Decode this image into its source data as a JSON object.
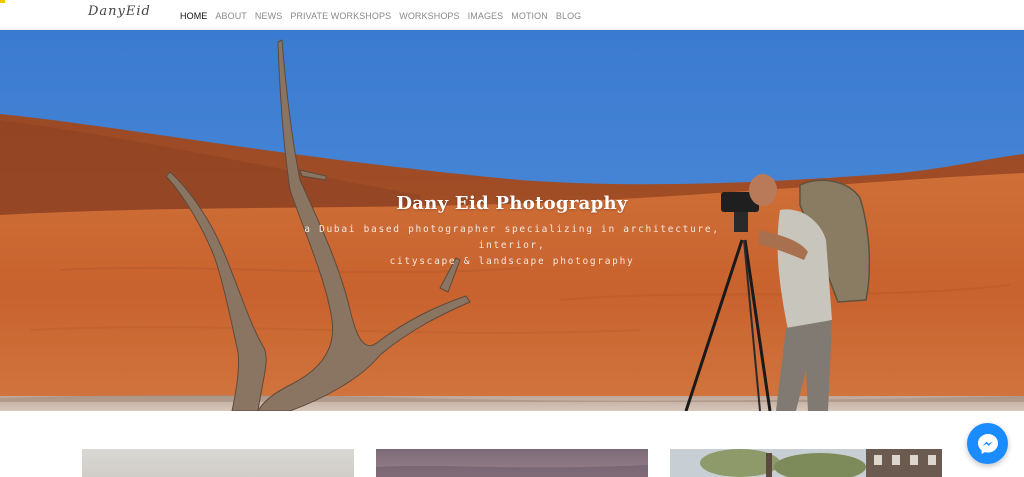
{
  "header": {
    "logo_text": "DanyEid",
    "nav": [
      {
        "label": "HOME",
        "active": true
      },
      {
        "label": "ABOUT"
      },
      {
        "label": "NEWS"
      },
      {
        "label": "PRIVATE WORKSHOPS"
      },
      {
        "label": "WORKSHOPS"
      },
      {
        "label": "IMAGES"
      },
      {
        "label": "MOTION"
      },
      {
        "label": "BLOG"
      }
    ]
  },
  "hero": {
    "title": "Dany Eid Photography",
    "subtitle_line1": "a Dubai based photographer specializing in architecture, interior,",
    "subtitle_line2": "cityscape & landscape photography"
  },
  "messenger": {
    "icon": "messenger-icon",
    "color": "#1a8cff"
  },
  "colors": {
    "sky": "#3c7fd2",
    "dune": "#c4622d",
    "accent": "#f5c400"
  }
}
